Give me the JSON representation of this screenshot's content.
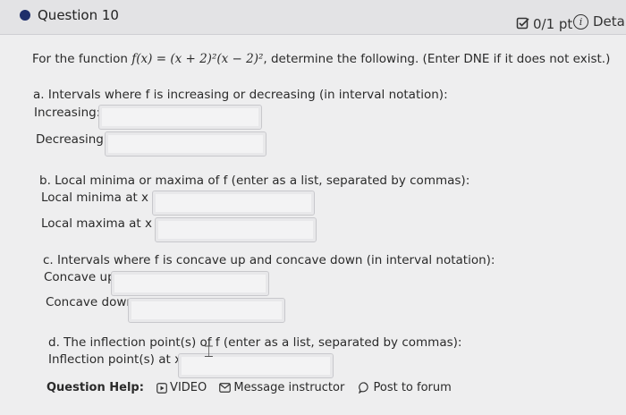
{
  "header": {
    "question_title": "Question 10",
    "score": "0/1 pt",
    "details_label": "Deta"
  },
  "prompt": {
    "lead": "For the function",
    "function_expr": "f(x) = (x + 2)²(x − 2)²",
    "tail": ", determine the following. (Enter DNE if it does not exist.)"
  },
  "part_a": {
    "question": "a. Intervals where f is increasing or decreasing (in interval notation):",
    "increasing_label": "Increasing:",
    "decreasing_label": "Decreasing:"
  },
  "part_b": {
    "question": "b. Local minima or maxima of f (enter as a list, separated by commas):",
    "minima_label": "Local minima at x =",
    "maxima_label": "Local maxima at x ="
  },
  "part_c": {
    "question": "c. Intervals where f is concave up and concave down (in interval notation):",
    "concave_up_label": "Concave up:",
    "concave_down_label": "Concave down:"
  },
  "part_d": {
    "question": "d. The inflection point(s) of f (enter as a list, separated by commas):",
    "inflection_label": "Inflection point(s) at x ="
  },
  "help": {
    "label": "Question Help:",
    "video": "VIDEO",
    "message": "Message instructor",
    "forum": "Post to forum"
  },
  "colors": {
    "accent": "#1f2f6b",
    "background": "#eeeeef",
    "header_bg": "#e3e3e5"
  }
}
